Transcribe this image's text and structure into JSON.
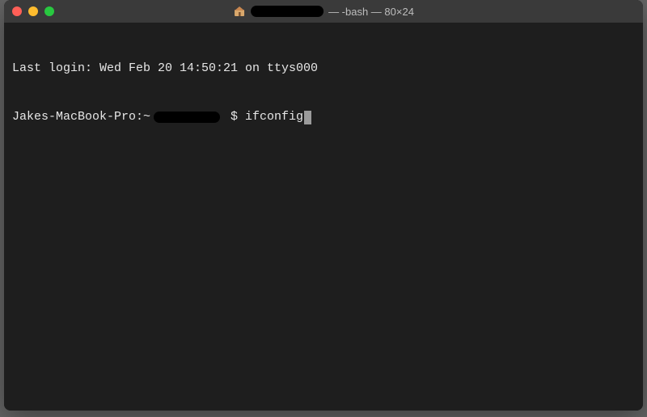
{
  "window": {
    "title_suffix": "— -bash — 80×24",
    "icon_name": "home-folder-icon"
  },
  "terminal": {
    "last_login_line": "Last login: Wed Feb 20 14:50:21 on ttys000",
    "prompt": {
      "host": "Jakes-MacBook-Pro:~",
      "symbol": " $ ",
      "command": "ifconfig"
    }
  }
}
